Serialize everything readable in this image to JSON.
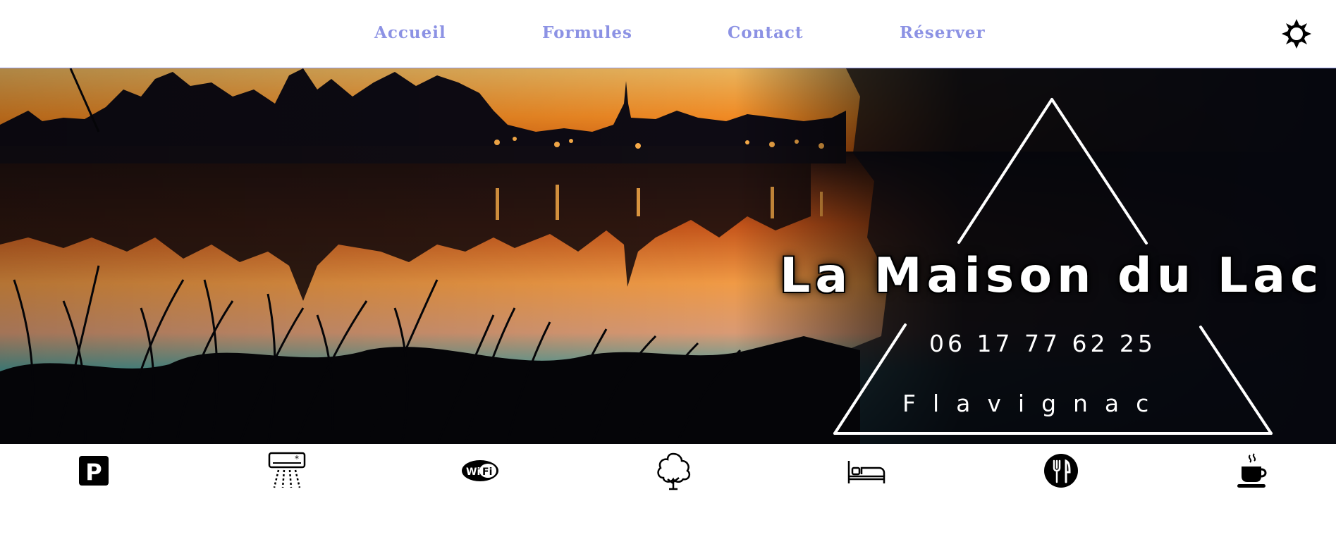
{
  "nav": {
    "items": [
      {
        "label": "Accueil"
      },
      {
        "label": "Formules"
      },
      {
        "label": "Contact"
      },
      {
        "label": "Réserver"
      }
    ],
    "theme_toggle_icon": "sun-icon"
  },
  "hero": {
    "title": "La Maison du Lac",
    "phone": "06 17 77 62 25",
    "town": "Flavignac"
  },
  "amenities": [
    {
      "icon": "parking-icon"
    },
    {
      "icon": "air-conditioning-icon"
    },
    {
      "icon": "wifi-icon"
    },
    {
      "icon": "tree-icon"
    },
    {
      "icon": "bed-icon"
    },
    {
      "icon": "restaurant-icon"
    },
    {
      "icon": "coffee-cup-icon"
    }
  ],
  "colors": {
    "nav_link": "#8c92e4",
    "nav_border": "#8c92e4",
    "title_text": "#ffffff",
    "background": "#ffffff",
    "icon": "#000000"
  }
}
